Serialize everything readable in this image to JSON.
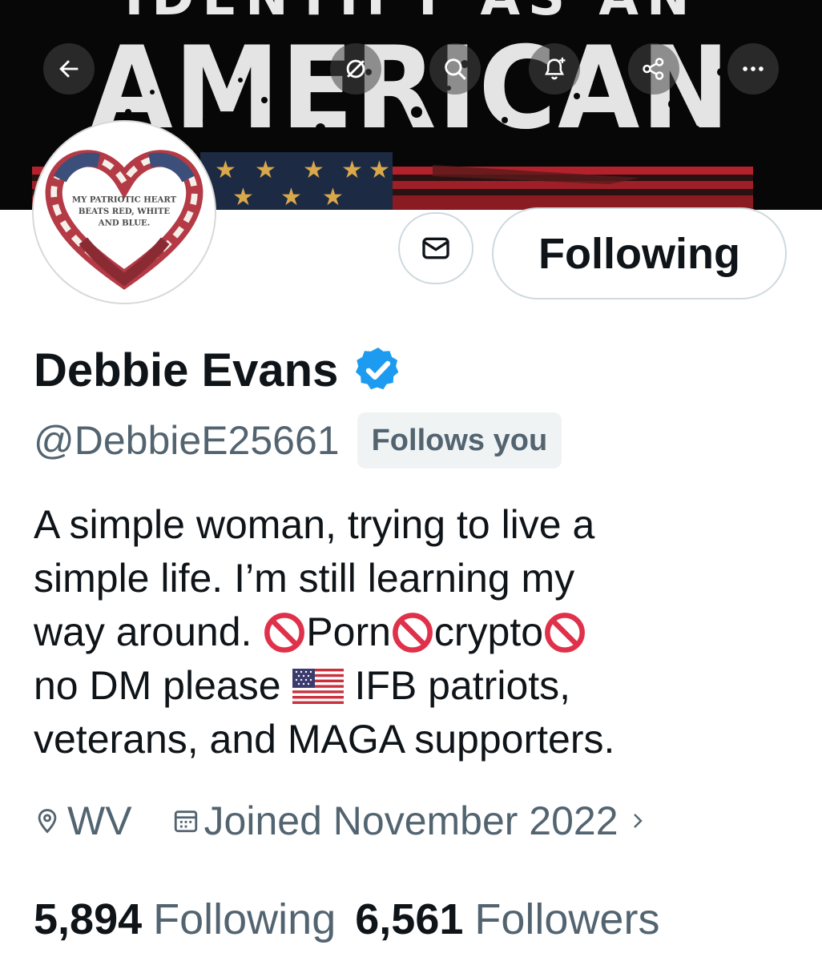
{
  "banner": {
    "line1": "IDENTIFY AS AN",
    "line2": "AMERICAN"
  },
  "top_nav": {
    "icons": [
      "back-arrow-icon",
      "hide-reposts-icon",
      "search-icon",
      "notification-bell-plus-icon",
      "share-icon",
      "more-options-icon"
    ]
  },
  "avatar": {
    "caption_lines": [
      "MY PATRIOTIC HEART",
      "BEATS RED, WHITE",
      "AND BLUE."
    ]
  },
  "actions": {
    "message_icon": "envelope-icon",
    "follow_label": "Following"
  },
  "profile": {
    "name": "Debbie Evans",
    "verified": true,
    "verified_color": "#1d9bf0",
    "handle": "@DebbieE25661",
    "follows_you": "Follows you"
  },
  "bio": {
    "line1": "A simple woman, trying to live a",
    "line2": "simple life. I’m still learning my",
    "line3_a": "way around. ",
    "line3_b": "Porn",
    "line3_c": "crypto",
    "line4_a": "no DM please",
    "line4_b": "IFB patriots,",
    "line5": "veterans, and MAGA supporters."
  },
  "meta": {
    "location": "WV",
    "joined": "Joined November 2022"
  },
  "stats": {
    "following_count": "5,894",
    "following_label": "Following",
    "followers_count": "6,561",
    "followers_label": "Followers"
  },
  "colors": {
    "text_primary": "#0f1419",
    "text_secondary": "#536471",
    "border": "#cfd9de",
    "badge_bg": "#eff3f4",
    "no_entry_red": "#e0314b"
  }
}
